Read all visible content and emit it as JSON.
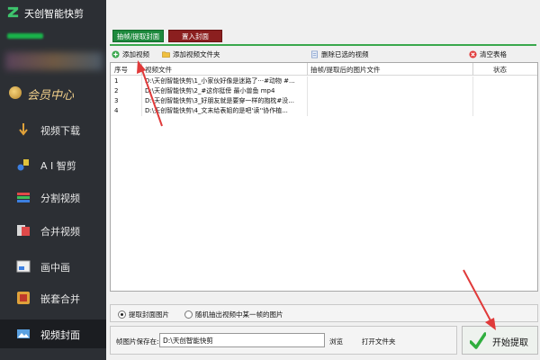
{
  "app": {
    "title": "天创智能快剪"
  },
  "sidebar": {
    "member_label": "会员中心",
    "items": [
      {
        "label": "视频下载",
        "icon": "download-arrow-icon"
      },
      {
        "label": "A I 智剪",
        "icon": "ai-edit-icon"
      },
      {
        "label": "分割视频",
        "icon": "split-video-icon"
      },
      {
        "label": "合并视频",
        "icon": "merge-video-icon"
      },
      {
        "label": "画中画",
        "icon": "picture-in-picture-icon"
      },
      {
        "label": "嵌套合并",
        "icon": "nested-merge-icon"
      },
      {
        "label": "视频封面",
        "icon": "video-cover-icon",
        "active": true
      }
    ]
  },
  "tabs": {
    "extract_cover": "抽帧/提取封面",
    "insert_cover": "置入封面"
  },
  "toolbar": {
    "add_video": "添加视频",
    "add_folder": "添加视频文件夹",
    "delete_selected": "删除已选的视频",
    "clear_table": "清空表格"
  },
  "table": {
    "headers": [
      "序号",
      "视频文件",
      "抽帧/提取后的图片文件",
      "状态"
    ],
    "rows": [
      {
        "index": "1",
        "file": "D:\\天创智能快剪\\1_小家伙好像是迷路了···#动物 #...",
        "output": "",
        "status": ""
      },
      {
        "index": "2",
        "file": "D:\\天创智能快剪\\2_#这你挺傍 最小兽鱼 mp4",
        "output": "",
        "status": ""
      },
      {
        "index": "3",
        "file": "D:\\天创智能快剪\\3_好朋友就是要穿一样的抱枕#没...",
        "output": "",
        "status": ""
      },
      {
        "index": "4",
        "file": "D:\\天创智能快剪\\4_文末给表姐的是吧'读''协作植...",
        "output": "",
        "status": ""
      }
    ]
  },
  "options": {
    "extract_cover_image": "提取封面图片",
    "random_frame": "随机抽出视频中某一帧的图片",
    "selected": "extract_cover_image"
  },
  "save": {
    "label": "帧图片保存在:",
    "path": "D:\\天创智能快剪",
    "browse": "浏览",
    "open_folder": "打开文件夹"
  },
  "start_button": "开始提取",
  "colors": {
    "sidebar_bg": "#2c2f34",
    "extract_tab": "#1e8a3e",
    "insert_tab": "#8b1f1f",
    "accent_green": "#3aa84d",
    "annotation_red": "#e03a3a"
  }
}
